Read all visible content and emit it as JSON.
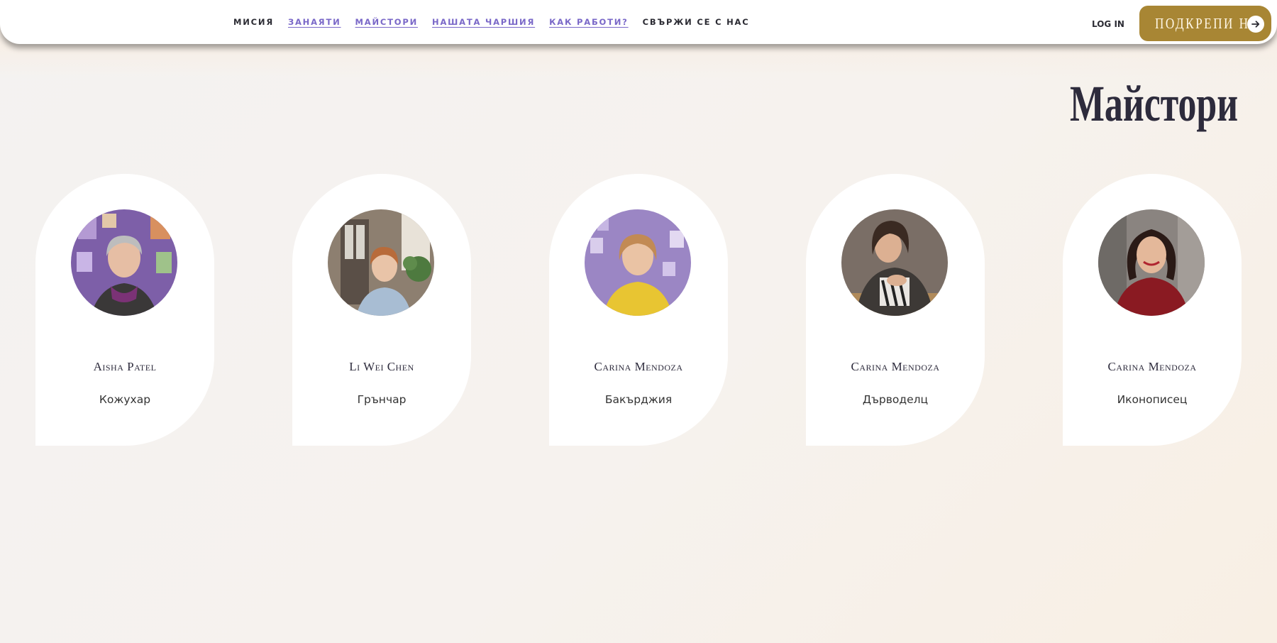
{
  "nav": {
    "links": [
      {
        "label": "МИСИЯ",
        "underlined": false
      },
      {
        "label": "ЗАНАЯТИ",
        "underlined": true
      },
      {
        "label": "МАЙСТОРИ",
        "underlined": true
      },
      {
        "label": "НАШАТА ЧАРШИЯ",
        "underlined": true
      },
      {
        "label": "КАК РАБОТИ?",
        "underlined": true
      },
      {
        "label": "СВЪРЖИ СЕ С НАС",
        "underlined": false
      }
    ],
    "login_label": "LOG IN",
    "support_label": "ПОДКРЕПИ НИ",
    "support_icon": "arrow-right-icon"
  },
  "page": {
    "title": "Майстори"
  },
  "makers": [
    {
      "name": "Aisha Patel",
      "craft": "Кожухар"
    },
    {
      "name": "Li Wei Chen",
      "craft": "Грънчар"
    },
    {
      "name": "Carina Mendoza",
      "craft": "Бакърджия"
    },
    {
      "name": "Carina Mendoza",
      "craft": "Дърводелц"
    },
    {
      "name": "Carina Mendoza",
      "craft": "Иконописец"
    }
  ],
  "colors": {
    "accent_gold": "#a88634",
    "link_purple": "#7a68c8",
    "title_dark": "#2d2b3c"
  }
}
